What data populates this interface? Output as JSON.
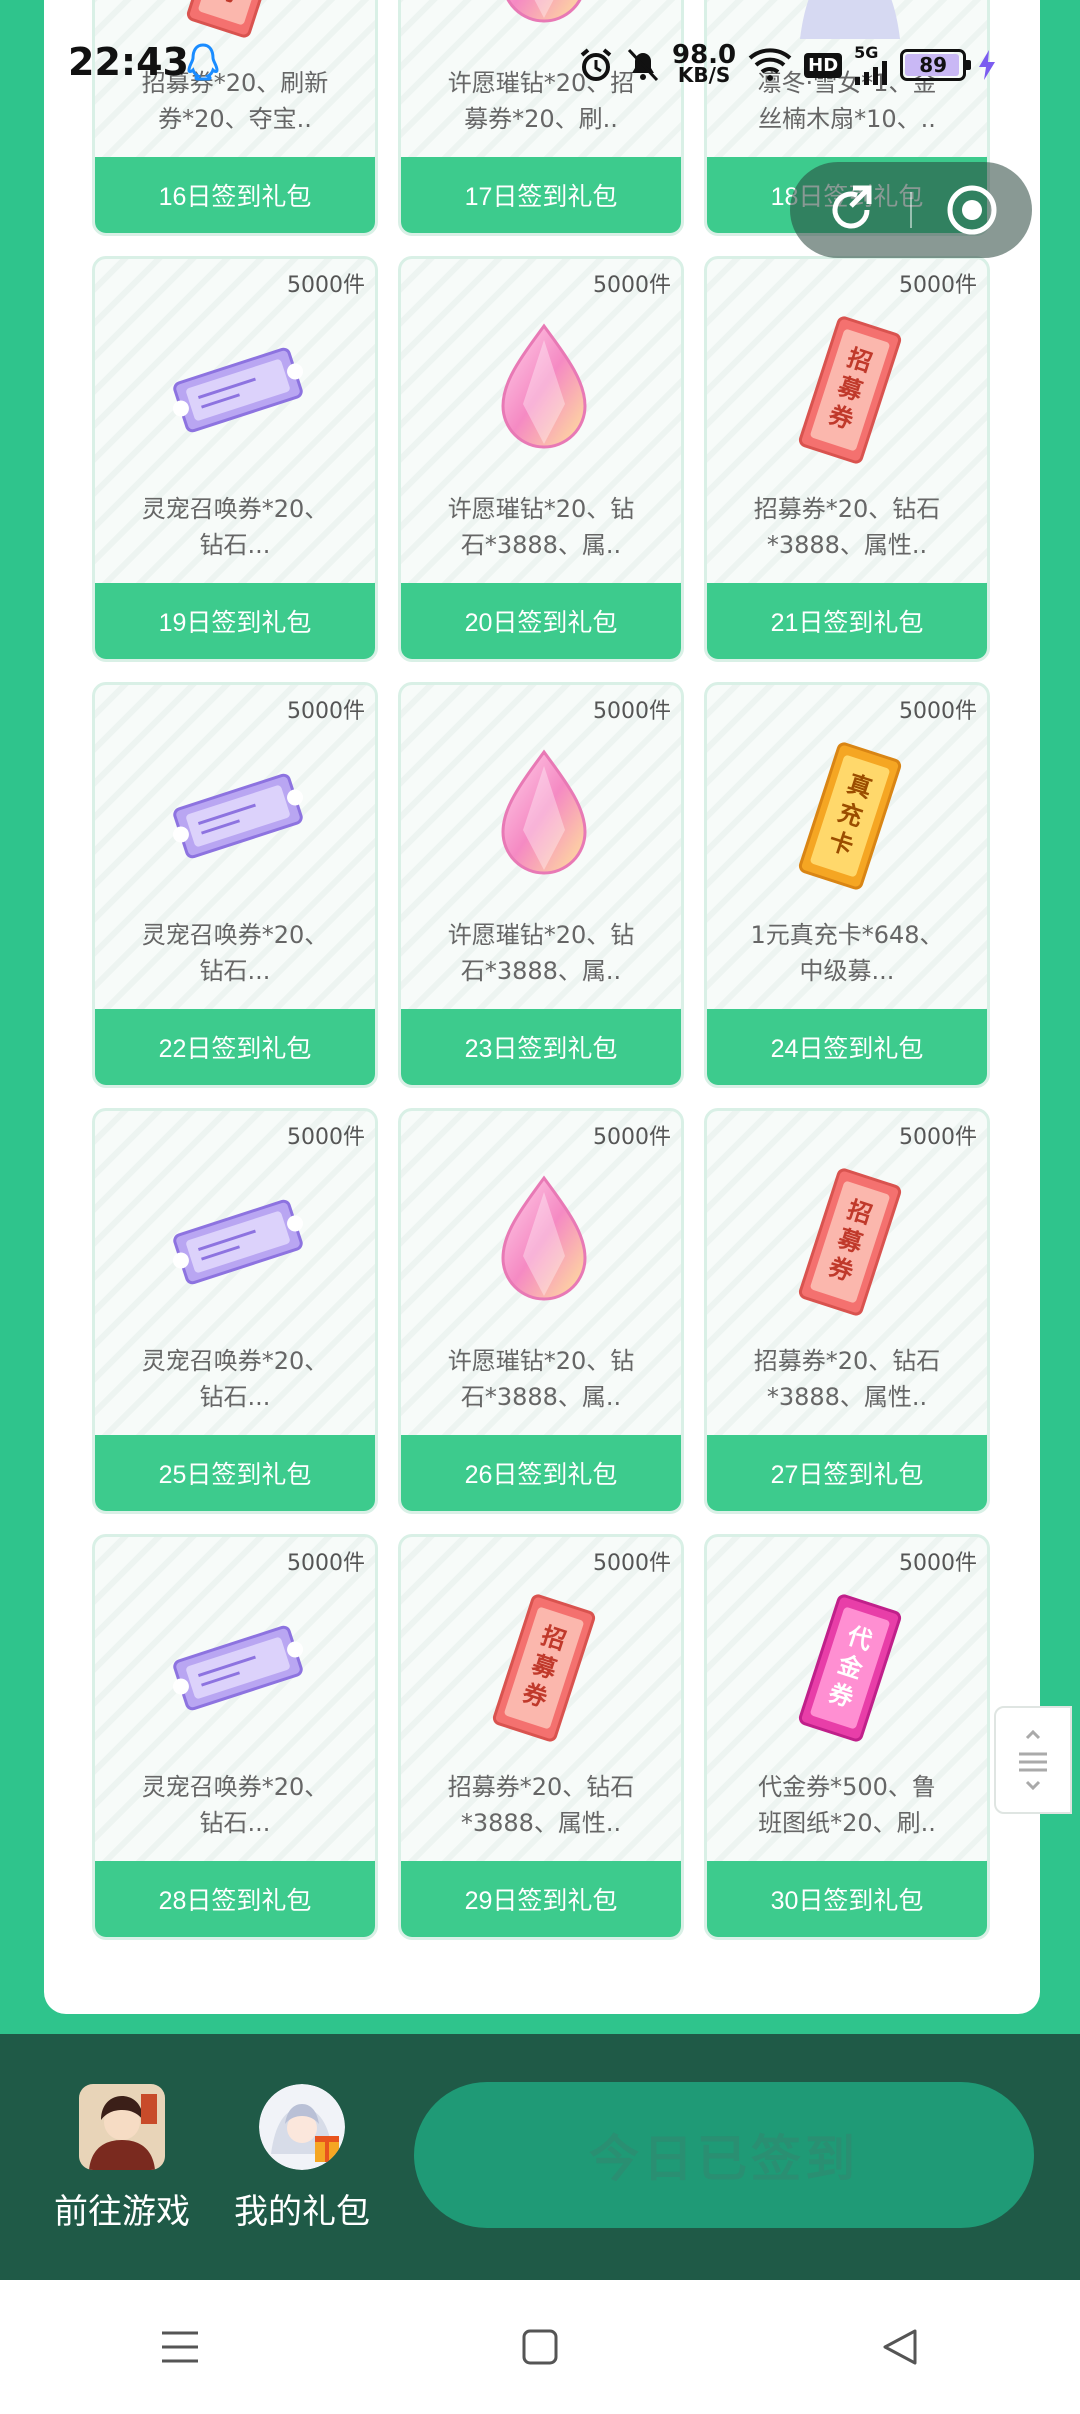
{
  "status": {
    "time": "22:43",
    "net_speed_value": "98.0",
    "net_speed_unit": "KB/S",
    "hd": "HD",
    "signal": "5G",
    "battery": "89"
  },
  "gifts": [
    {
      "qty": "",
      "desc": "招募券*20、刷新券*20、夺宝..",
      "button": "16日签到礼包",
      "icon": "recruit-ticket"
    },
    {
      "qty": "",
      "desc": "许愿璀钻*20、招募券*20、刷..",
      "button": "17日签到礼包",
      "icon": "wish-diamond"
    },
    {
      "qty": "",
      "desc": "凛冬·雪女*1、金丝楠木扇*10、..",
      "button": "18日签到礼包",
      "icon": "character"
    },
    {
      "qty": "5000件",
      "desc": "灵宠召唤券*20、钻石...",
      "button": "19日签到礼包",
      "icon": "pet-summon-ticket"
    },
    {
      "qty": "5000件",
      "desc": "许愿璀钻*20、钻石*3888、属..",
      "button": "20日签到礼包",
      "icon": "wish-diamond"
    },
    {
      "qty": "5000件",
      "desc": "招募券*20、钻石*3888、属性..",
      "button": "21日签到礼包",
      "icon": "recruit-ticket"
    },
    {
      "qty": "5000件",
      "desc": "灵宠召唤券*20、钻石...",
      "button": "22日签到礼包",
      "icon": "pet-summon-ticket"
    },
    {
      "qty": "5000件",
      "desc": "许愿璀钻*20、钻石*3888、属..",
      "button": "23日签到礼包",
      "icon": "wish-diamond"
    },
    {
      "qty": "5000件",
      "desc": "1元真充卡*648、中级募...",
      "button": "24日签到礼包",
      "icon": "recharge-card"
    },
    {
      "qty": "5000件",
      "desc": "灵宠召唤券*20、钻石...",
      "button": "25日签到礼包",
      "icon": "pet-summon-ticket"
    },
    {
      "qty": "5000件",
      "desc": "许愿璀钻*20、钻石*3888、属..",
      "button": "26日签到礼包",
      "icon": "wish-diamond"
    },
    {
      "qty": "5000件",
      "desc": "招募券*20、钻石*3888、属性..",
      "button": "27日签到礼包",
      "icon": "recruit-ticket"
    },
    {
      "qty": "5000件",
      "desc": "灵宠召唤券*20、钻石...",
      "button": "28日签到礼包",
      "icon": "pet-summon-ticket"
    },
    {
      "qty": "5000件",
      "desc": "招募券*20、钻石*3888、属性..",
      "button": "29日签到礼包",
      "icon": "recruit-ticket"
    },
    {
      "qty": "5000件",
      "desc": "代金券*500、鲁班图纸*20、刷..",
      "button": "30日签到礼包",
      "icon": "voucher"
    }
  ],
  "ticket_text": {
    "recruit": "招募券",
    "recharge": "真充卡",
    "voucher": "代金券"
  },
  "bottom": {
    "go_game": "前往游戏",
    "my_gifts": "我的礼包",
    "signed": "今日已签到"
  },
  "colors": {
    "background": "#2fc48c",
    "button": "#3dcb8d",
    "bottom_bar": "#1f5a47"
  }
}
